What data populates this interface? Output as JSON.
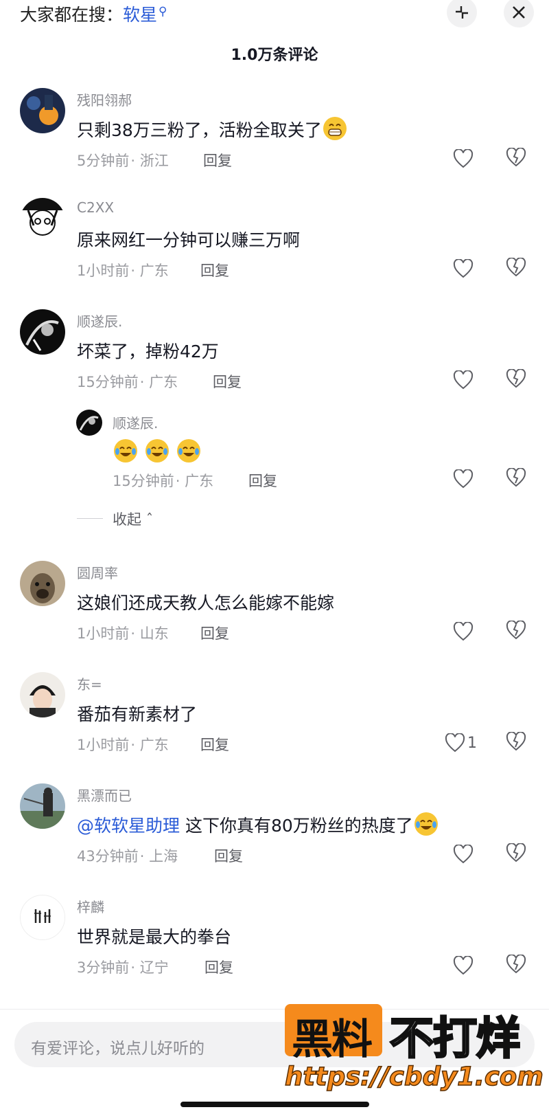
{
  "top": {
    "search_prefix": "大家都在搜：",
    "search_keyword": "软星",
    "search_icon": "search-icon",
    "collapse_icon": "collapse-arrows-icon",
    "close_icon": "close-icon"
  },
  "comment_count": "1.0万条评论",
  "comments": [
    {
      "username": "残阳翎郝",
      "text": "只剩38万三粉了，活粉全取关了",
      "emoji": "grin-emoji",
      "time": "5分钟前",
      "location": "· 浙江",
      "reply": "回复",
      "likes": ""
    },
    {
      "username": "C2XX",
      "text": "原来网红一分钟可以赚三万啊",
      "time": "1小时前",
      "location": "· 广东",
      "reply": "回复",
      "likes": ""
    },
    {
      "username": "顺遂辰.",
      "text": "坏菜了，掉粉42万",
      "time": "15分钟前",
      "location": "· 广东",
      "reply": "回复",
      "likes": ""
    },
    {
      "username": "圆周率",
      "text": "这娘们还成天教人怎么能嫁不能嫁",
      "time": "1小时前",
      "location": "· 山东",
      "reply": "回复",
      "likes": ""
    },
    {
      "username": "东=",
      "text": "番茄有新素材了",
      "time": "1小时前",
      "location": "· 广东",
      "reply": "回复",
      "likes": "1"
    },
    {
      "username": "黑漂而已",
      "mention": "@软软星助理",
      "text": " 这下你真有80万粉丝的热度了",
      "emoji": "crying-laugh-emoji",
      "time": "43分钟前",
      "location": "· 上海",
      "reply": "回复",
      "likes": ""
    },
    {
      "username": "梓麟",
      "text": "世界就是最大的拳台",
      "time": "3分钟前",
      "location": "· 辽宁",
      "reply": "回复",
      "likes": ""
    }
  ],
  "sub_reply": {
    "username": "顺遂辰.",
    "emojis": [
      "tears-of-joy-emoji",
      "tears-of-joy-emoji",
      "tears-of-joy-emoji"
    ],
    "time": "15分钟前",
    "location": "· 广东",
    "reply": "回复"
  },
  "collapse_label": "收起",
  "input_placeholder": "有爱评论，说点儿好听的",
  "watermark": {
    "brand_box": "黑料",
    "brand_rest": "不打烊",
    "url": "https://cbdy1.com"
  },
  "colors": {
    "mention": "#2a5bd7",
    "watermark_orange": "#f58a1c"
  }
}
